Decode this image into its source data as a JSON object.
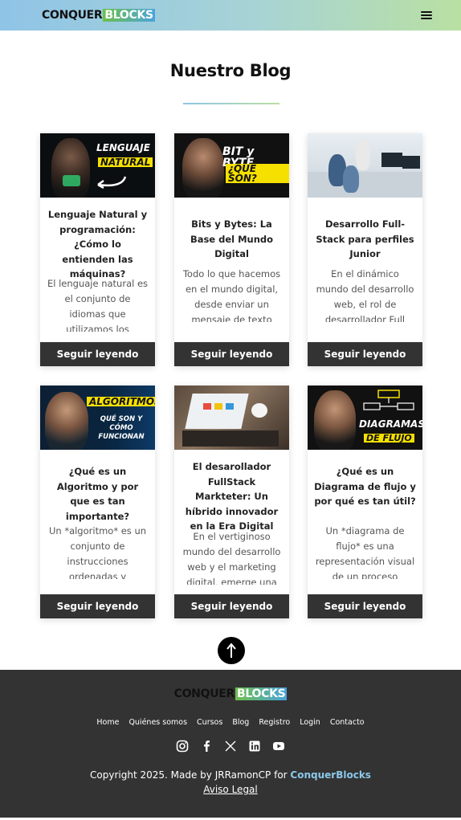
{
  "header": {
    "logo_conquer": "CONQUER",
    "logo_blocks": "BLOCKS"
  },
  "page": {
    "title": "Nuestro Blog"
  },
  "posts": [
    {
      "image_text_1": "LENGUAJE",
      "image_text_2": "NATURAL",
      "title": "Lenguaje Natural y programación: ¿Cómo lo entienden las máquinas?",
      "excerpt": "El lenguaje natural es el conjunto de idiomas que utilizamos los",
      "button": "Seguir leyendo"
    },
    {
      "image_text_1": "BIT y BYTE",
      "image_text_2": "¿QUÉ SON?",
      "title": "Bits y Bytes: La Base del Mundo Digital",
      "excerpt": "Todo lo que hacemos en el mundo digital, desde enviar un mensaje de texto",
      "button": "Seguir leyendo"
    },
    {
      "image_text_1": "",
      "image_text_2": "",
      "title": "Desarrollo Full-Stack para perfiles Junior",
      "excerpt": "En el dinámico mundo del desarrollo web, el rol de desarrollador Full",
      "button": "Seguir leyendo"
    },
    {
      "image_text_1": "ALGORITMOS",
      "image_text_2": "QUÉ SON Y CÓMO FUNCIONAN",
      "title": "¿Qué es un Algoritmo y por que es tan importante?",
      "excerpt": "Un *algoritmo* es un conjunto de instrucciones ordenadas y",
      "button": "Seguir leyendo"
    },
    {
      "image_text_1": "",
      "image_text_2": "",
      "title": "El desarollador FullStack Markteter: Un híbrido innovador en la Era Digital",
      "excerpt": "En el vertiginoso mundo del desarrollo web y el marketing digital, emerge una",
      "button": "Seguir leyendo"
    },
    {
      "image_text_1": "DIAGRAMAS",
      "image_text_2": "DE FLUJO",
      "title": "¿Qué es un Diagrama de flujo y por qué es tan útil?",
      "excerpt": "Un *diagrama de flujo* es una representación visual de un proceso",
      "button": "Seguir leyendo"
    }
  ],
  "footer": {
    "nav": [
      "Home",
      "Quiénes somos",
      "Cursos",
      "Blog",
      "Registro",
      "Login",
      "Contacto"
    ],
    "social": [
      "instagram-icon",
      "facebook-icon",
      "x-icon",
      "linkedin-icon",
      "youtube-icon"
    ],
    "copyright": "Copyright 2025. Made by JRRamonCP for",
    "brand": "ConquerBlocks",
    "legal": "Aviso Legal"
  },
  "colors": {
    "header_start": "#8fc4e6",
    "header_end": "#b9e0a2",
    "button_bg": "#333333",
    "footer_bg": "#333333",
    "brand_link": "#8cc8ea",
    "highlight_yellow": "#f5e000"
  }
}
